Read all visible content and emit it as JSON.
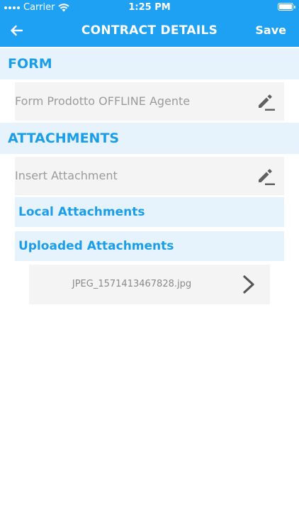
{
  "status_bar": {
    "carrier": "Carrier",
    "time": "1:25 PM"
  },
  "nav": {
    "title": "CONTRACT DETAILS",
    "save_label": "Save",
    "back_icon": "arrow-left-icon"
  },
  "form_section": {
    "title": "FORM",
    "item_label": "Form Prodotto OFFLINE Agente",
    "item_icon": "pencil-edit-icon"
  },
  "attachments_section": {
    "title": "ATTACHMENTS",
    "insert_label": "Insert Attachment",
    "insert_icon": "pencil-edit-icon",
    "local_label": "Local Attachments",
    "uploaded_label": "Uploaded Attachments",
    "files": [
      {
        "name": "JPEG_1571413467828.jpg"
      }
    ]
  },
  "colors": {
    "accent": "#1ea1f2",
    "section_bg": "#e6f3fc",
    "section_text": "#1b9de8",
    "row_bg": "#f4f4f4",
    "row_text": "#9b9b9b"
  }
}
